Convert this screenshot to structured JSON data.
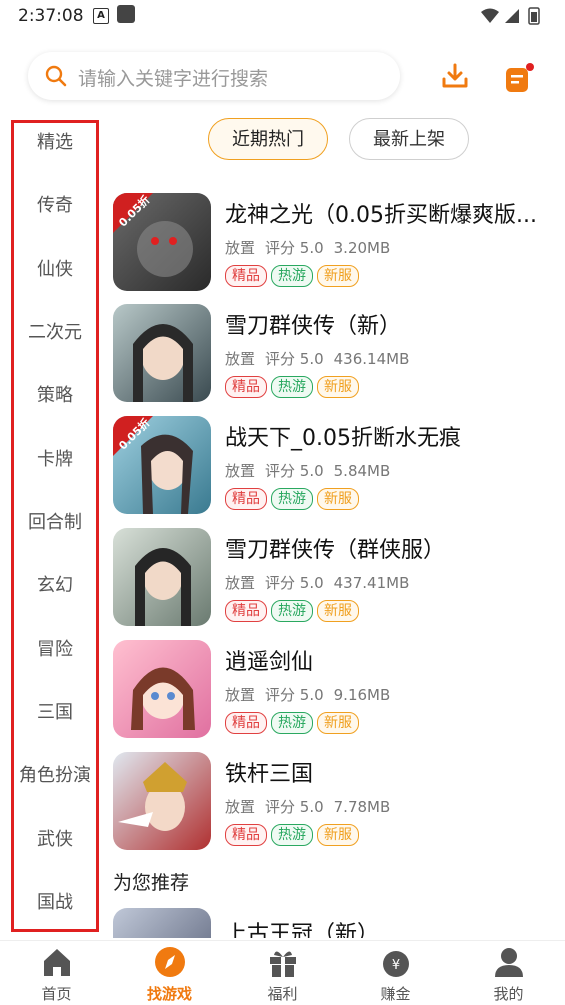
{
  "status": {
    "time": "2:37:08"
  },
  "search": {
    "placeholder": "请输入关键字进行搜索"
  },
  "sidebar": {
    "items": [
      "精选",
      "传奇",
      "仙侠",
      "二次元",
      "策略",
      "卡牌",
      "回合制",
      "玄幻",
      "冒险",
      "三国",
      "角色扮演",
      "武侠",
      "国战"
    ]
  },
  "tabs": {
    "active": "近期热门",
    "inactive": "最新上架"
  },
  "games": [
    {
      "name": "龙神之光（0.05折买断爆爽版...",
      "type": "放置",
      "rating": "评分 5.0",
      "size": "3.20MB",
      "badge": "0.05折"
    },
    {
      "name": "雪刀群侠传（新）",
      "type": "放置",
      "rating": "评分 5.0",
      "size": "436.14MB"
    },
    {
      "name": "战天下_0.05折断水无痕",
      "type": "放置",
      "rating": "评分 5.0",
      "size": "5.84MB",
      "badge": "0.05折"
    },
    {
      "name": "雪刀群侠传（群侠服）",
      "type": "放置",
      "rating": "评分 5.0",
      "size": "437.41MB"
    },
    {
      "name": "逍遥剑仙",
      "type": "放置",
      "rating": "评分 5.0",
      "size": "9.16MB"
    },
    {
      "name": "铁杆三国",
      "type": "放置",
      "rating": "评分 5.0",
      "size": "7.78MB"
    }
  ],
  "tags": {
    "t1": "精品",
    "t2": "热游",
    "t3": "新服"
  },
  "recommend": {
    "title": "为您推荐",
    "partial_game": "上古王冠（新）"
  },
  "nav": {
    "items": [
      "首页",
      "找游戏",
      "福利",
      "赚金",
      "我的"
    ],
    "active": "找游戏"
  },
  "colors": {
    "accent": "#f07a10",
    "highlight_border": "#e02020"
  }
}
